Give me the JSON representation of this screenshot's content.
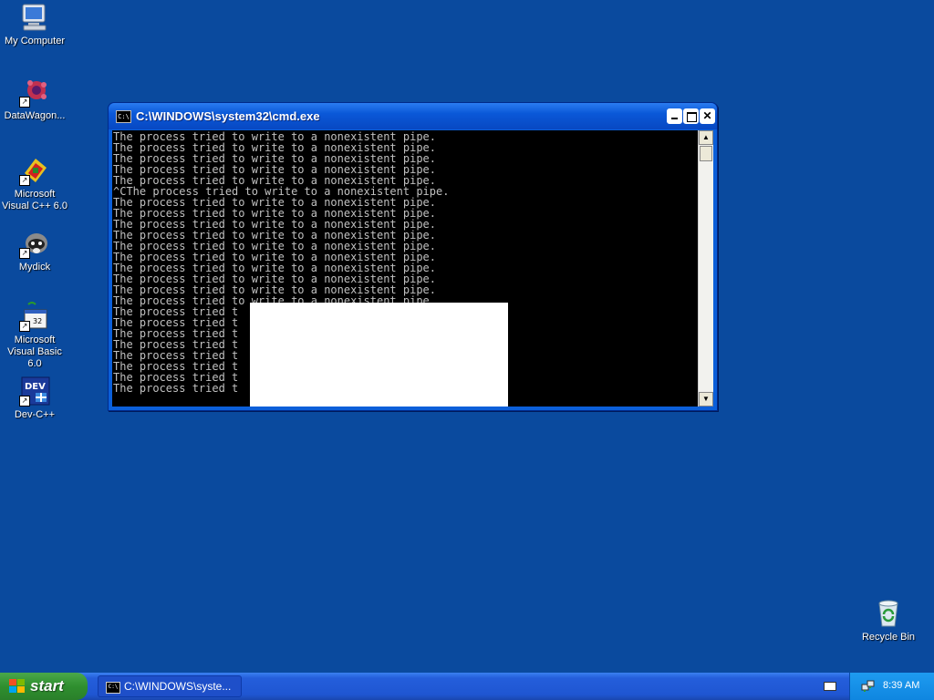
{
  "desktop": {
    "icons": [
      {
        "label": "My Computer"
      },
      {
        "label": "DataWagon..."
      },
      {
        "label": "Microsoft Visual C++ 6.0"
      },
      {
        "label": "Mydick"
      },
      {
        "label": "Microsoft Visual Basic 6.0"
      },
      {
        "label": "Dev-C++"
      },
      {
        "label": "Recycle Bin"
      }
    ],
    "background_color": "#0a4a9e"
  },
  "window": {
    "title": "C:\\WINDOWS\\system32\\cmd.exe",
    "icon_text": "C:\\",
    "console_lines": [
      "The process tried to write to a nonexistent pipe.",
      "The process tried to write to a nonexistent pipe.",
      "The process tried to write to a nonexistent pipe.",
      "The process tried to write to a nonexistent pipe.",
      "The process tried to write to a nonexistent pipe.",
      "^CThe process tried to write to a nonexistent pipe.",
      "The process tried to write to a nonexistent pipe.",
      "The process tried to write to a nonexistent pipe.",
      "The process tried to write to a nonexistent pipe.",
      "The process tried to write to a nonexistent pipe.",
      "The process tried to write to a nonexistent pipe.",
      "The process tried to write to a nonexistent pipe.",
      "The process tried to write to a nonexistent pipe.",
      "The process tried to write to a nonexistent pipe.",
      "The process tried to write to a nonexistent pipe.",
      "The process tried to write to a nonexistent pipe.",
      "The process tried t",
      "The process tried t",
      "The process tried t",
      "The process tried t",
      "The process tried t",
      "The process tried t",
      "The process tried t",
      "The process tried t"
    ]
  },
  "taskbar": {
    "start_label": "start",
    "task_item_label": "C:\\WINDOWS\\syste...",
    "clock": "8:39 AM"
  }
}
